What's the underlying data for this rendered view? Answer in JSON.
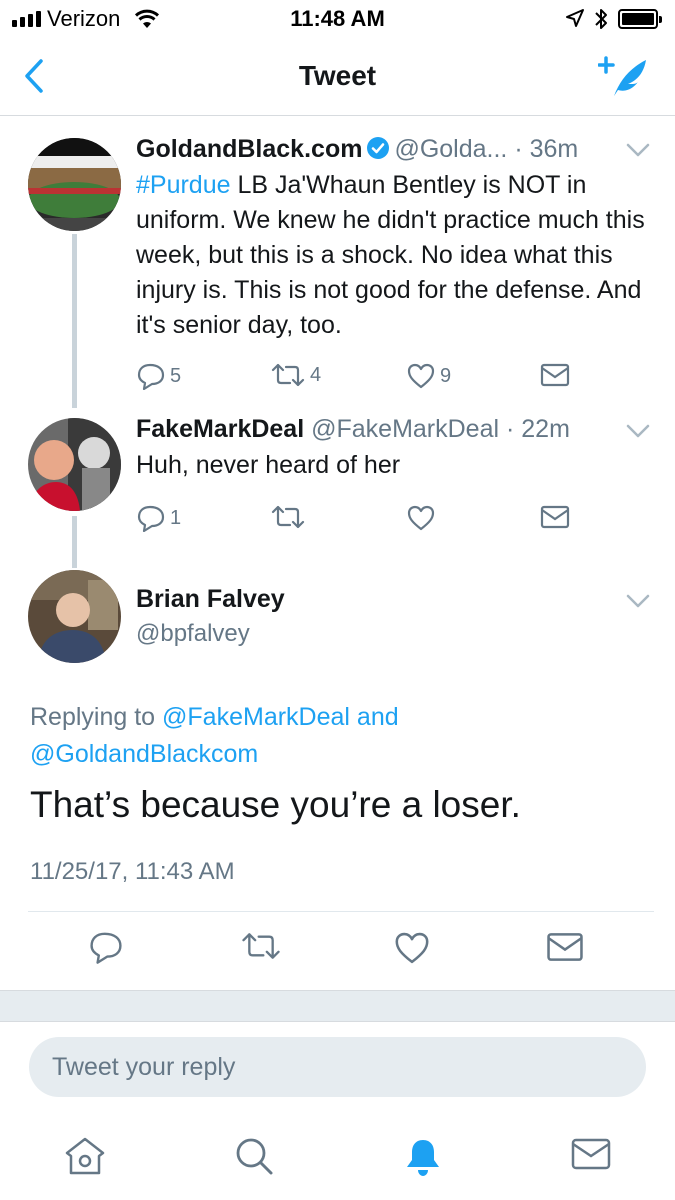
{
  "status_bar": {
    "carrier": "Verizon",
    "time": "11:48 AM",
    "icons": [
      "signal-icon",
      "wifi-icon",
      "location-icon",
      "bluetooth-icon",
      "battery-icon"
    ]
  },
  "nav": {
    "title": "Tweet",
    "back_icon": "chevron-left-icon",
    "compose_icon": "compose-tweet-icon"
  },
  "colors": {
    "accent": "#1da1f2",
    "text": "#14171a",
    "muted": "#657786",
    "thread_line": "#c9d3da",
    "band": "#e6ecf0"
  },
  "tweets": [
    {
      "name": "GoldandBlack.com",
      "verified": true,
      "handle": "@Golda...",
      "time": "· 36m",
      "hashtag": "#Purdue",
      "text": " LB Ja'Whaun Bentley is NOT in uniform. We knew he didn't practice much this week, but this is a shock. No idea what this injury is. This is not good for the defense. And it's senior day, too.",
      "replies": "5",
      "retweets": "4",
      "likes": "9"
    },
    {
      "name": "FakeMarkDeal",
      "handle": "@FakeMarkDeal",
      "time": "· 22m",
      "text": "Huh, never heard of her",
      "replies": "1",
      "retweets": "",
      "likes": ""
    }
  ],
  "focused": {
    "name": "Brian Falvey",
    "handle": "@bpfalvey",
    "replying_prefix": "Replying to ",
    "mention_1": "@FakeMarkDeal",
    "and_word": " and",
    "mention_2": "@GoldandBlackcom",
    "text": "That’s because you’re a loser.",
    "timestamp": "11/25/17, 11:43 AM"
  },
  "reply": {
    "placeholder": "Tweet your reply"
  },
  "tab_bar": {
    "items": [
      "home-icon",
      "search-icon",
      "notifications-bell-icon",
      "messages-icon"
    ],
    "active": "notifications-bell-icon"
  }
}
